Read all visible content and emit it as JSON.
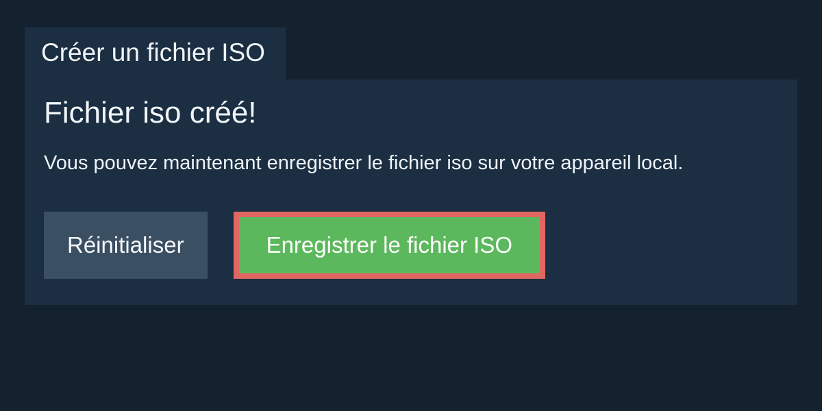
{
  "tab": {
    "label": "Créer un fichier ISO"
  },
  "main": {
    "heading": "Fichier iso créé!",
    "description": "Vous pouvez maintenant enregistrer le fichier iso sur votre appareil local."
  },
  "buttons": {
    "reset": "Réinitialiser",
    "save": "Enregistrer le fichier ISO"
  }
}
